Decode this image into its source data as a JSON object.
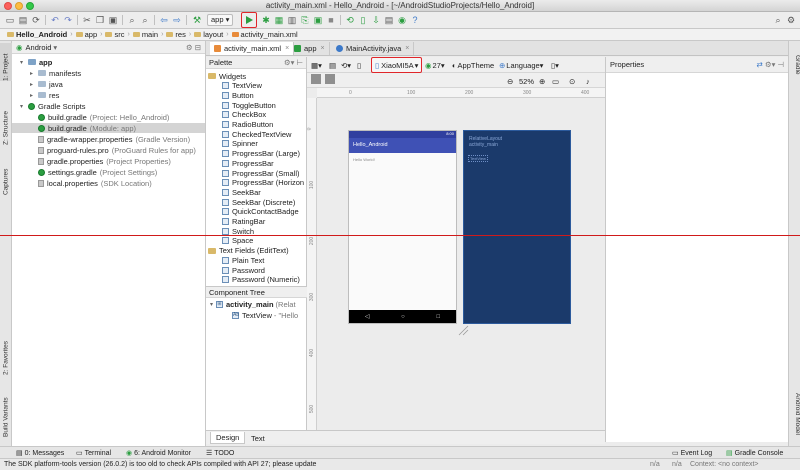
{
  "window": {
    "title": "activity_main.xml - Hello_Android - [~/AndroidStudioProjects/Hello_Android]"
  },
  "toolbar": {
    "app_config": "app",
    "dropdown": "▾"
  },
  "breadcrumb": [
    "Hello_Android",
    "app",
    "src",
    "main",
    "res",
    "layout",
    "activity_main.xml"
  ],
  "left_strip": {
    "project": "1: Project",
    "structure": "Z: Structure",
    "captures": "Captures",
    "favorites": "2: Favorites",
    "build_variants": "Build Variants"
  },
  "right_strip": {
    "gradle": "Gradle",
    "android_model": "Android Model"
  },
  "project_panel": {
    "view_selector": "Android",
    "tree": [
      {
        "label": "app",
        "extra": "",
        "indent": 0,
        "kind": "module",
        "caret": "▾",
        "selected": false
      },
      {
        "label": "manifests",
        "extra": "",
        "indent": 1,
        "kind": "folder",
        "caret": "▸",
        "selected": false
      },
      {
        "label": "java",
        "extra": "",
        "indent": 1,
        "kind": "folder",
        "caret": "▸",
        "selected": false
      },
      {
        "label": "res",
        "extra": "",
        "indent": 1,
        "kind": "folder",
        "caret": "▸",
        "selected": false
      },
      {
        "label": "Gradle Scripts",
        "extra": "",
        "indent": 0,
        "kind": "gradle",
        "caret": "▾",
        "selected": false
      },
      {
        "label": "build.gradle",
        "extra": "(Project: Hello_Android)",
        "indent": 1,
        "kind": "gradle",
        "caret": "",
        "selected": false
      },
      {
        "label": "build.gradle",
        "extra": "(Module: app)",
        "indent": 1,
        "kind": "gradle",
        "caret": "",
        "selected": true
      },
      {
        "label": "gradle-wrapper.properties",
        "extra": "(Gradle Version)",
        "indent": 1,
        "kind": "props",
        "caret": "",
        "selected": false
      },
      {
        "label": "proguard-rules.pro",
        "extra": "(ProGuard Rules for app)",
        "indent": 1,
        "kind": "props",
        "caret": "",
        "selected": false
      },
      {
        "label": "gradle.properties",
        "extra": "(Project Properties)",
        "indent": 1,
        "kind": "props",
        "caret": "",
        "selected": false
      },
      {
        "label": "settings.gradle",
        "extra": "(Project Settings)",
        "indent": 1,
        "kind": "gradle",
        "caret": "",
        "selected": false
      },
      {
        "label": "local.properties",
        "extra": "(SDK Location)",
        "indent": 1,
        "kind": "props",
        "caret": "",
        "selected": false
      }
    ]
  },
  "editor_tabs": [
    {
      "label": "activity_main.xml",
      "active": true
    },
    {
      "label": "app",
      "active": false
    },
    {
      "label": "MainActivity.java",
      "active": false
    }
  ],
  "palette": {
    "title": "Palette",
    "items": [
      {
        "label": "Widgets",
        "kind": "category"
      },
      {
        "label": "TextView",
        "kind": "widget"
      },
      {
        "label": "Button",
        "kind": "widget"
      },
      {
        "label": "ToggleButton",
        "kind": "widget"
      },
      {
        "label": "CheckBox",
        "kind": "widget"
      },
      {
        "label": "RadioButton",
        "kind": "widget"
      },
      {
        "label": "CheckedTextView",
        "kind": "widget"
      },
      {
        "label": "Spinner",
        "kind": "widget"
      },
      {
        "label": "ProgressBar (Large)",
        "kind": "widget"
      },
      {
        "label": "ProgressBar",
        "kind": "widget"
      },
      {
        "label": "ProgressBar (Small)",
        "kind": "widget"
      },
      {
        "label": "ProgressBar (Horizon",
        "kind": "widget"
      },
      {
        "label": "SeekBar",
        "kind": "widget"
      },
      {
        "label": "SeekBar (Discrete)",
        "kind": "widget"
      },
      {
        "label": "QuickContactBadge",
        "kind": "widget"
      },
      {
        "label": "RatingBar",
        "kind": "widget"
      },
      {
        "label": "Switch",
        "kind": "widget"
      },
      {
        "label": "Space",
        "kind": "widget"
      },
      {
        "label": "Text Fields (EditText)",
        "kind": "category"
      },
      {
        "label": "Plain Text",
        "kind": "widget"
      },
      {
        "label": "Password",
        "kind": "widget"
      },
      {
        "label": "Password (Numeric)",
        "kind": "widget"
      }
    ]
  },
  "component_tree": {
    "title": "Component Tree",
    "root": {
      "label": "activity_main",
      "extra": "(Relat"
    },
    "child": {
      "label": "TextView",
      "extra": "- \"Hello"
    }
  },
  "design_toolbar": {
    "device": "XiaoMI5A",
    "api": "27",
    "theme": "AppTheme",
    "language": "Language",
    "zoom": "52%"
  },
  "canvas": {
    "ruler_top": [
      "0",
      "100",
      "200",
      "300",
      "400"
    ],
    "ruler_left": [
      "0",
      "100",
      "200",
      "300",
      "400",
      "500"
    ],
    "phone_title": "Hello_Android",
    "phone_text": "Hello World!",
    "phone_nav": [
      "◁",
      "○",
      "□"
    ],
    "status_time": "8:00",
    "blueprint_line1": "RelativeLayout",
    "blueprint_line2": "activity_main",
    "blueprint_tv": "TextView"
  },
  "properties": {
    "title": "Properties"
  },
  "bottom_tabs": [
    {
      "label": "Design",
      "active": true
    },
    {
      "label": "Text",
      "active": false
    }
  ],
  "tool_windows": {
    "messages": "0: Messages",
    "terminal": "Terminal",
    "android_monitor": "6: Android Monitor",
    "todo": "TODO",
    "event_log": "Event Log",
    "gradle_console": "Gradle Console"
  },
  "status": {
    "message": "The SDK platform-tools version (26.0.2) is too old  to check APIs compiled with API 27; please update",
    "pos1": "n/a",
    "pos2": "n/a",
    "context": "Context: <no context>"
  },
  "colors": {
    "accent_red": "#e0262a",
    "run_green": "#2c9e41",
    "phone_appbar": "#3f51b5",
    "blueprint": "#1b3a6b"
  }
}
